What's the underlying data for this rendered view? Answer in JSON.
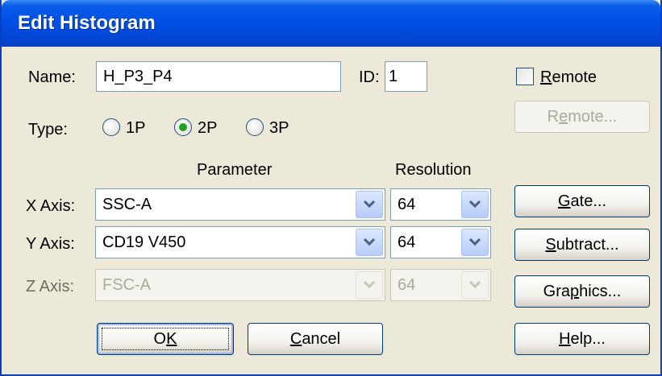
{
  "window": {
    "title": "Edit Histogram"
  },
  "name": {
    "label": "Name:",
    "value": "H_P3_P4"
  },
  "id": {
    "label": "ID:",
    "value": "1"
  },
  "remote_check": {
    "label_prefix": "",
    "label_ul": "R",
    "label_rest": "emote",
    "checked": false
  },
  "remote_button": {
    "label_prefix": "R",
    "label_ul": "e",
    "label_rest": "mote...",
    "enabled": false
  },
  "type": {
    "label": "Type:",
    "options": [
      {
        "label": "1P",
        "selected": false
      },
      {
        "label": "2P",
        "selected": true
      },
      {
        "label": "3P",
        "selected": false
      }
    ]
  },
  "headers": {
    "parameter": "Parameter",
    "resolution": "Resolution"
  },
  "axes": {
    "x": {
      "label": "X Axis:",
      "parameter": "SSC-A",
      "resolution": "64",
      "enabled": true
    },
    "y": {
      "label": "Y Axis:",
      "parameter": "CD19 V450",
      "resolution": "64",
      "enabled": true
    },
    "z": {
      "label": "Z Axis:",
      "parameter": "FSC-A",
      "resolution": "64",
      "enabled": false
    }
  },
  "buttons": {
    "gate": {
      "label_prefix": "",
      "label_ul": "G",
      "label_rest": "ate..."
    },
    "subtract": {
      "label_prefix": "",
      "label_ul": "S",
      "label_rest": "ubtract..."
    },
    "graphics": {
      "label_prefix": "Gra",
      "label_ul": "p",
      "label_rest": "hics..."
    },
    "help": {
      "label_prefix": "",
      "label_ul": "H",
      "label_rest": "elp..."
    },
    "ok": {
      "label_prefix": "O",
      "label_ul": "K",
      "label_rest": ""
    },
    "cancel": {
      "label_prefix": "",
      "label_ul": "C",
      "label_rest": "ancel"
    }
  },
  "colors": {
    "titlebar": "#0050e6",
    "dialog_bg": "#ece9d8",
    "radio_dot": "#21a121"
  }
}
